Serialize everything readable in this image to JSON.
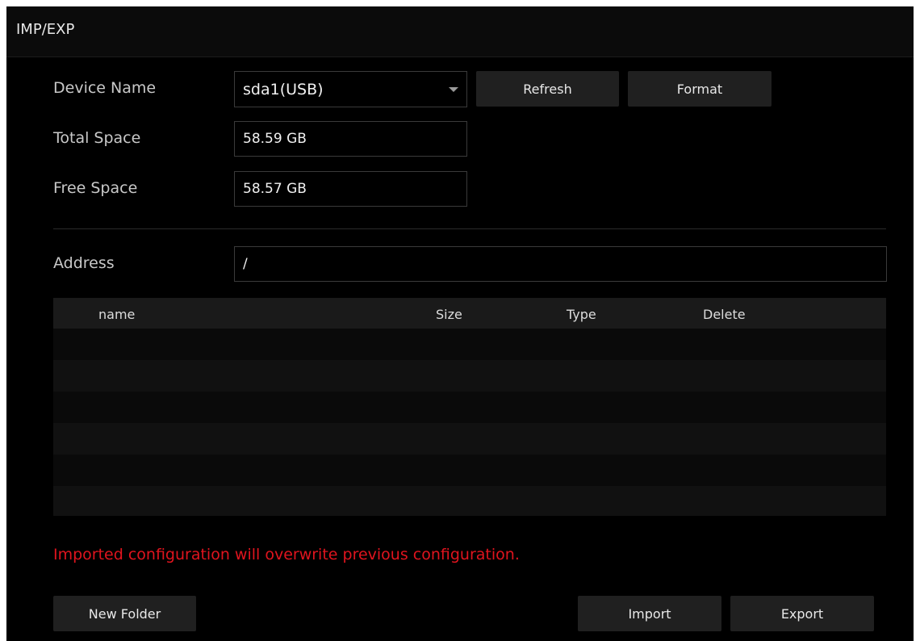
{
  "window": {
    "title": "IMP/EXP"
  },
  "device": {
    "name_label": "Device Name",
    "name_value": "sda1(USB)",
    "refresh_label": "Refresh",
    "format_label": "Format",
    "total_space_label": "Total Space",
    "total_space_value": "58.59 GB",
    "free_space_label": "Free Space",
    "free_space_value": "58.57 GB"
  },
  "address": {
    "label": "Address",
    "value": "/"
  },
  "file_table": {
    "columns": [
      "name",
      "Size",
      "Type",
      "Delete"
    ],
    "rows": []
  },
  "warning": "Imported configuration will overwrite previous configuration.",
  "actions": {
    "new_folder_label": "New Folder",
    "import_label": "Import",
    "export_label": "Export"
  },
  "colors": {
    "background": "#000000",
    "warning": "#e0141e",
    "button": "#202020"
  }
}
